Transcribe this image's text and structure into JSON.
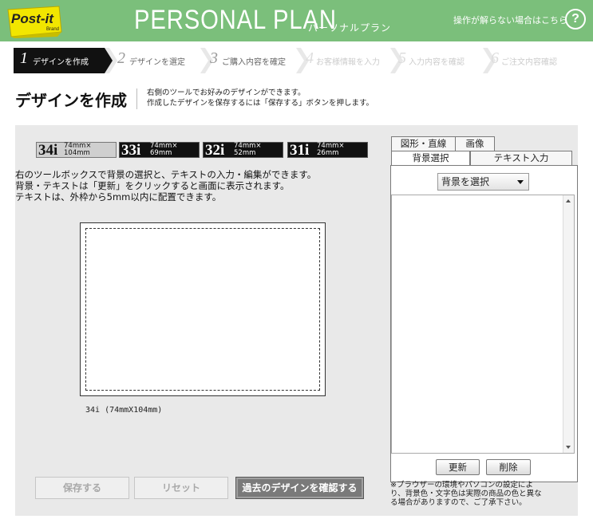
{
  "header": {
    "logo_text": "Post-it",
    "logo_subtext": "Brand",
    "brand": "PERSONAL PLAN",
    "brand_sub": "パーソナルプラン",
    "help_link": "操作が解らない場合はこちら",
    "help_icon_text": "?"
  },
  "steps": [
    {
      "num": "1",
      "label": "デザインを作成",
      "state": "active"
    },
    {
      "num": "2",
      "label": "デザインを選定",
      "state": "inactive"
    },
    {
      "num": "3",
      "label": "ご購入内容を確定",
      "state": "inactive"
    },
    {
      "num": "4",
      "label": "お客様情報を入力",
      "state": "disabled"
    },
    {
      "num": "5",
      "label": "入力内容を確認",
      "state": "disabled"
    },
    {
      "num": "6",
      "label": "ご注文内容確認",
      "state": "disabled"
    }
  ],
  "title": {
    "text": "デザインを作成",
    "desc1": "右側のツールでお好みのデザインができます。",
    "desc2": "作成したデザインを保存するには「保存する」ボタンを押します。"
  },
  "sizes": [
    {
      "code": "34i",
      "dim1": "74mm×",
      "dim2": "104mm",
      "active": true
    },
    {
      "code": "33i",
      "dim1": "74mm×",
      "dim2": "69mm",
      "active": false
    },
    {
      "code": "32i",
      "dim1": "74mm×",
      "dim2": "52mm",
      "active": false
    },
    {
      "code": "31i",
      "dim1": "74mm×",
      "dim2": "26mm",
      "active": false
    }
  ],
  "instructions": [
    "右のツールボックスで背景の選択と、テキストの入力・編集ができます。",
    "背景・テキストは「更新」をクリックすると画面に表示されます。",
    "テキストは、外枠から5mm以内に配置できます。"
  ],
  "canvas_caption": "34i (74mmX104mm)",
  "buttons": {
    "save": "保存する",
    "reset": "リセット",
    "past": "過去のデザインを確認する"
  },
  "tool_tabs": {
    "shapes": "図形・直線",
    "image": "画像",
    "background": "背景選択",
    "text": "テキスト入力"
  },
  "bg_select": {
    "value": "背景を選択"
  },
  "tool_buttons": {
    "update": "更新",
    "delete": "削除"
  },
  "note": [
    "※ブラウザーの環境やパソコンの設定によ",
    "り、背景色・文字色は実際の商品の色と異な",
    "る場合がありますので、ご了承下さい。"
  ],
  "colors": {
    "header_green": "#7bbf7b",
    "logo_yellow": "#f2e600",
    "active_step": "#111111"
  }
}
